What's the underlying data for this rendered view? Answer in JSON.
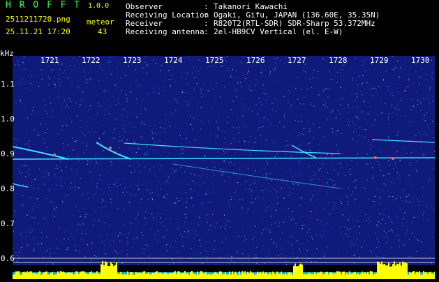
{
  "header": {
    "app_title": "H R O F F T",
    "version": "1.0.0",
    "filename": "2511211720.png",
    "datetime": "25.11.21 17:20",
    "meteor_label": "meteor",
    "meteor_count": "43"
  },
  "info": [
    {
      "key": "Observer",
      "sep": ":",
      "value": "Takanori Kawachi"
    },
    {
      "key": "Receiving Location",
      "sep": ":",
      "value": "Ogaki, Gifu, JAPAN (136.60E, 35.35N)"
    },
    {
      "key": "Receiver",
      "sep": ":",
      "value": "R820T2(RTL-SDR) SDR-Sharp 53.372MHz"
    },
    {
      "key": "Receiving antenna",
      "sep": ":",
      "value": "2el-HB9CV Vertical (el. E-W)"
    }
  ],
  "chart_data": {
    "type": "heatmap",
    "ylabel": "kHz",
    "x_ticks": [
      "1721",
      "1722",
      "1723",
      "1724",
      "1725",
      "1726",
      "1727",
      "1728",
      "1729",
      "1730"
    ],
    "y_ticks": [
      "1.1",
      "1.0",
      "0.9",
      "0.8",
      "0.7",
      "0.6"
    ],
    "ylim": [
      0.58,
      1.18
    ],
    "colors": {
      "background": "#101a7a",
      "trace": "#40e0ff",
      "hot": "#ff6060",
      "bottom_bar": "#ffff00"
    }
  }
}
